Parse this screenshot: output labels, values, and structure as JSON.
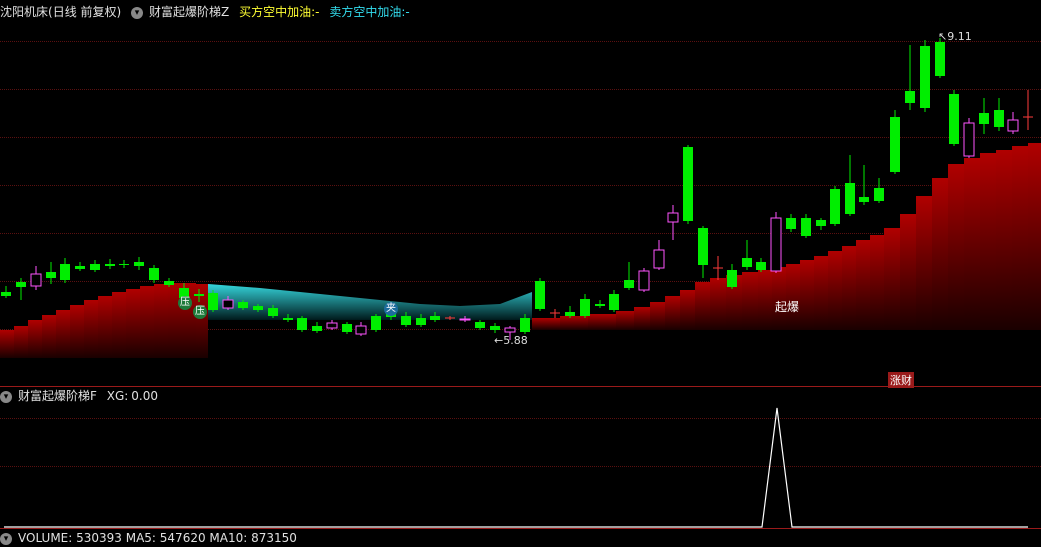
{
  "main_panel": {
    "stock_name": "沈阳机床",
    "period": "(日线 前复权)",
    "indicator_name": "财富起爆阶梯Z",
    "buy_label": "买方空中加油:",
    "buy_value": "-",
    "sell_label": "卖方空中加油:",
    "sell_value": "-",
    "high_label": "9.11",
    "low_label": "5.88",
    "ya_label": "压",
    "jia_label": "夹",
    "qibao_label": "起爆",
    "zhangcai_label": "涨财",
    "colors": {
      "up": "#ff55ff",
      "down": "#00ee00",
      "step_red": "#a00000",
      "cyan": "#22cfd6",
      "buy": "#ffff33",
      "sell": "#33ddee"
    }
  },
  "sub_panel": {
    "indicator_name": "财富起爆阶梯F",
    "xg_label": "XG:",
    "xg_value": "0.00"
  },
  "volume_panel": {
    "text": "VOLUME: 530393  MA5: 547620  MA10: 873150"
  }
}
